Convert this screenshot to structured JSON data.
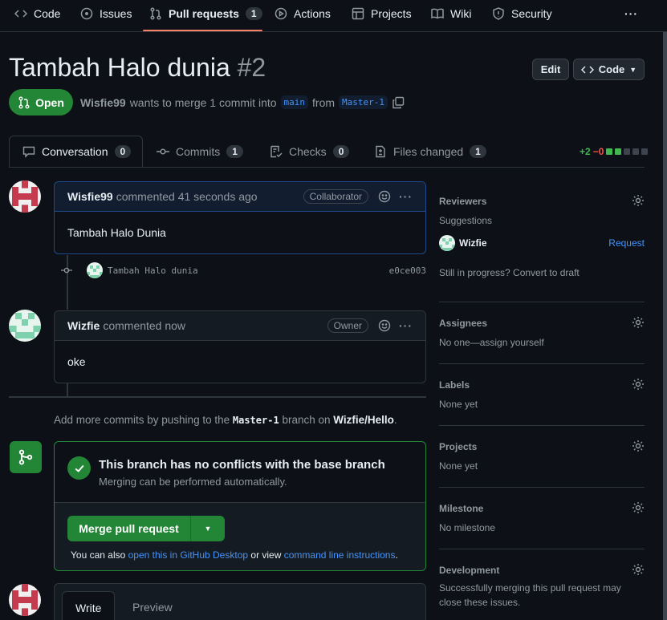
{
  "nav": {
    "code": "Code",
    "issues": "Issues",
    "pull_requests": "Pull requests",
    "pull_requests_count": "1",
    "actions": "Actions",
    "projects": "Projects",
    "wiki": "Wiki",
    "security": "Security",
    "more": "···"
  },
  "pr": {
    "title": "Tambah Halo dunia",
    "number": "#2",
    "edit_label": "Edit",
    "code_label": "Code",
    "state": "Open",
    "author": "Wisfie99",
    "merge_text_1": "wants to merge 1 commit into",
    "base_branch": "main",
    "from_text": "from",
    "head_branch": "Master-1"
  },
  "tabs": [
    {
      "label": "Conversation",
      "count": "0"
    },
    {
      "label": "Commits",
      "count": "1"
    },
    {
      "label": "Checks",
      "count": "0"
    },
    {
      "label": "Files changed",
      "count": "1"
    }
  ],
  "diffstat": {
    "additions": "+2",
    "deletions": "−0"
  },
  "comments": [
    {
      "author": "Wisfie99",
      "meta": "commented 41 seconds ago",
      "role": "Collaborator",
      "body": "Tambah Halo Dunia"
    },
    {
      "author": "Wizfie",
      "meta": "commented now",
      "role": "Owner",
      "body": "oke"
    }
  ],
  "commit": {
    "message": "Tambah Halo dunia",
    "sha": "e0ce003"
  },
  "push_note": {
    "prefix": "Add more commits by pushing to the",
    "branch": "Master-1",
    "middle": "branch on",
    "repo": "Wizfie/Hello",
    "suffix": "."
  },
  "merge": {
    "title": "This branch has no conflicts with the base branch",
    "subtitle": "Merging can be performed automatically.",
    "button": "Merge pull request",
    "note_prefix": "You can also",
    "note_link1": "open this in GitHub Desktop",
    "note_middle": "or view",
    "note_link2": "command line instructions",
    "note_suffix": "."
  },
  "composer": {
    "write": "Write",
    "preview": "Preview"
  },
  "sidebar": {
    "reviewers": {
      "heading": "Reviewers",
      "suggestions": "Suggestions",
      "suggested_user": "Wizfie",
      "request": "Request",
      "draft_note": "Still in progress? Convert to draft"
    },
    "assignees": {
      "heading": "Assignees",
      "value": "No one—assign yourself"
    },
    "labels": {
      "heading": "Labels",
      "value": "None yet"
    },
    "projects": {
      "heading": "Projects",
      "value": "None yet"
    },
    "milestone": {
      "heading": "Milestone",
      "value": "No milestone"
    },
    "development": {
      "heading": "Development",
      "value": "Successfully merging this pull request may close these issues."
    }
  },
  "colors": {
    "accent": "#4493f8",
    "success": "#238636",
    "nav_underline": "#f78166",
    "background": "#0d1117"
  }
}
